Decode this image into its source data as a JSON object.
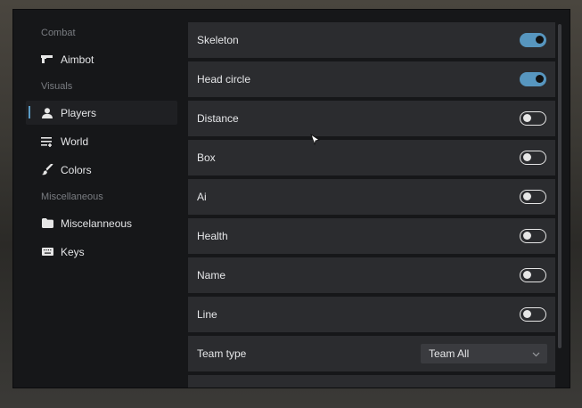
{
  "sidebar": {
    "sections": [
      {
        "title": "Combat",
        "items": [
          {
            "label": "Aimbot",
            "icon": "gun-icon",
            "active": false
          }
        ]
      },
      {
        "title": "Visuals",
        "items": [
          {
            "label": "Players",
            "icon": "user-icon",
            "active": true
          },
          {
            "label": "World",
            "icon": "list-icon",
            "active": false
          },
          {
            "label": "Colors",
            "icon": "brush-icon",
            "active": false
          }
        ]
      },
      {
        "title": "Miscellaneous",
        "items": [
          {
            "label": "Miscelanneous",
            "icon": "folder-icon",
            "active": false
          },
          {
            "label": "Keys",
            "icon": "keyboard-icon",
            "active": false
          }
        ]
      }
    ]
  },
  "settings": [
    {
      "label": "Skeleton",
      "type": "toggle",
      "on": true
    },
    {
      "label": "Head circle",
      "type": "toggle",
      "on": true
    },
    {
      "label": "Distance",
      "type": "toggle",
      "on": false
    },
    {
      "label": "Box",
      "type": "toggle",
      "on": false
    },
    {
      "label": "Ai",
      "type": "toggle",
      "on": false
    },
    {
      "label": "Health",
      "type": "toggle",
      "on": false
    },
    {
      "label": "Name",
      "type": "toggle",
      "on": false
    },
    {
      "label": "Line",
      "type": "toggle",
      "on": false
    },
    {
      "label": "Team type",
      "type": "select",
      "value": "Team All"
    }
  ],
  "colors": {
    "accent": "#5796bf",
    "panel": "#2b2c2f",
    "window": "#161719"
  }
}
